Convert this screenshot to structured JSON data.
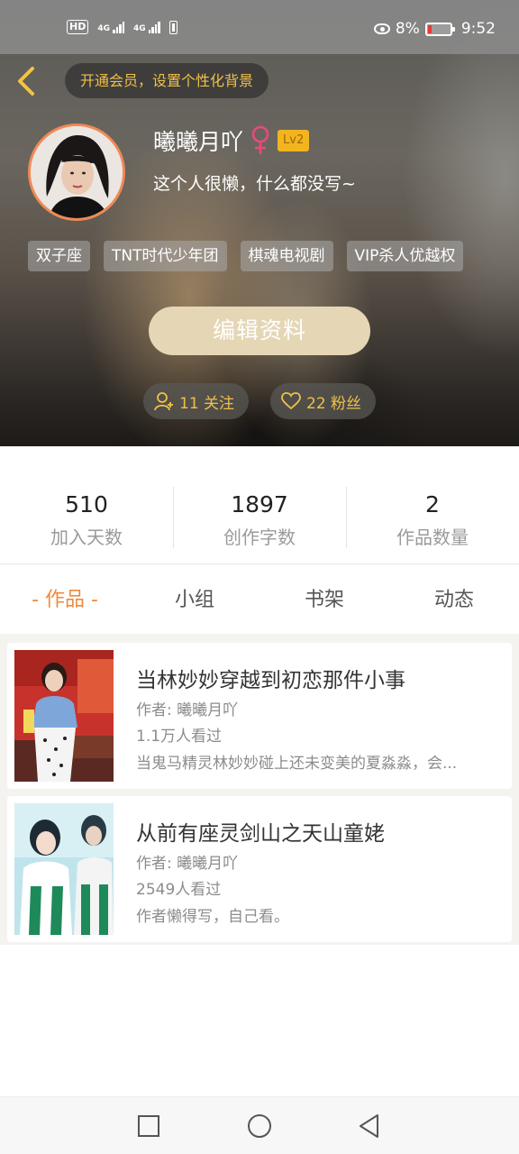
{
  "status_bar": {
    "hd": "HD",
    "net1": "4G",
    "net2": "4G",
    "battery_percent": "8%",
    "time": "9:52"
  },
  "header": {
    "vip_background_text": "开通会员，设置个性化背景",
    "username": "曦曦月吖",
    "gender_symbol": "♀",
    "level": "Lv2",
    "bio": "这个人很懒，什么都没写~",
    "tags": [
      "双子座",
      "TNT时代少年团",
      "棋魂电视剧",
      "VIP杀人优越权"
    ],
    "edit_profile_label": "编辑资料",
    "follow_label": "11 关注",
    "fans_label": "22 粉丝"
  },
  "stats": [
    {
      "value": "510",
      "label": "加入天数"
    },
    {
      "value": "1897",
      "label": "创作字数"
    },
    {
      "value": "2",
      "label": "作品数量"
    }
  ],
  "tabs": [
    "- 作品 -",
    "小组",
    "书架",
    "动态"
  ],
  "works": [
    {
      "title": "当林妙妙穿越到初恋那件小事",
      "author": "作者: 曦曦月吖",
      "views": "1.1万人看过",
      "description": "当鬼马精灵林妙妙碰上还未变美的夏淼淼，会..."
    },
    {
      "title": "从前有座灵剑山之天山童姥",
      "author": "作者: 曦曦月吖",
      "views": "2549人看过",
      "description": "作者懒得写，自己看。"
    }
  ],
  "colors": {
    "accent_orange": "#f08a3c",
    "gold_text": "#f0c04a",
    "edit_button": "#e5d6b5",
    "level_badge": "#f2b51f",
    "gender_pink": "#e94a7a"
  },
  "icons": {
    "back": "chevron-left-icon",
    "follow": "add-user-icon",
    "fans": "heart-icon",
    "nav": [
      "square-icon",
      "circle-icon",
      "triangle-back-icon"
    ]
  }
}
